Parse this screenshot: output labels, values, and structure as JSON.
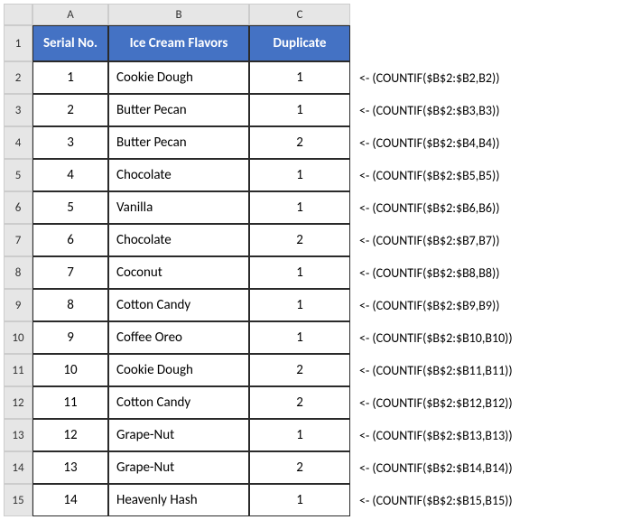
{
  "columns": {
    "rowhdr": "",
    "A": "A",
    "B": "B",
    "C": "C"
  },
  "rowNumbers": [
    "1",
    "2",
    "3",
    "4",
    "5",
    "6",
    "7",
    "8",
    "9",
    "10",
    "11",
    "12",
    "13",
    "14",
    "15"
  ],
  "headers": {
    "A": "Serial No.",
    "B": "Ice Cream Flavors",
    "C": "Duplicate"
  },
  "rows": [
    {
      "A": "1",
      "B": "Cookie Dough",
      "C": "1",
      "F": "<-  (COUNTIF($B$2:$B2,B2))"
    },
    {
      "A": "2",
      "B": "Butter Pecan",
      "C": "1",
      "F": "<-  (COUNTIF($B$2:$B3,B3))"
    },
    {
      "A": "3",
      "B": "Butter Pecan",
      "C": "2",
      "F": "<-  (COUNTIF($B$2:$B4,B4))"
    },
    {
      "A": "4",
      "B": "Chocolate",
      "C": "1",
      "F": "<-  (COUNTIF($B$2:$B5,B5))"
    },
    {
      "A": "5",
      "B": "Vanilla",
      "C": "1",
      "F": "<-  (COUNTIF($B$2:$B6,B6))"
    },
    {
      "A": "6",
      "B": "Chocolate",
      "C": "2",
      "F": "<-  (COUNTIF($B$2:$B7,B7))"
    },
    {
      "A": "7",
      "B": "Coconut",
      "C": "1",
      "F": "<-  (COUNTIF($B$2:$B8,B8))"
    },
    {
      "A": "8",
      "B": "Cotton Candy",
      "C": "1",
      "F": "<-  (COUNTIF($B$2:$B9,B9))"
    },
    {
      "A": "9",
      "B": "Coffee Oreo",
      "C": "1",
      "F": "<-  (COUNTIF($B$2:$B10,B10))"
    },
    {
      "A": "10",
      "B": "Cookie Dough",
      "C": "2",
      "F": "<-  (COUNTIF($B$2:$B11,B11))"
    },
    {
      "A": "11",
      "B": "Cotton Candy",
      "C": "2",
      "F": "<-  (COUNTIF($B$2:$B12,B12))"
    },
    {
      "A": "12",
      "B": "Grape-Nut",
      "C": "1",
      "F": "<-  (COUNTIF($B$2:$B13,B13))"
    },
    {
      "A": "13",
      "B": "Grape-Nut",
      "C": "2",
      "F": "<-  (COUNTIF($B$2:$B14,B14))"
    },
    {
      "A": "14",
      "B": "Heavenly Hash",
      "C": "1",
      "F": "<-  (COUNTIF($B$2:$B15,B15))"
    }
  ]
}
